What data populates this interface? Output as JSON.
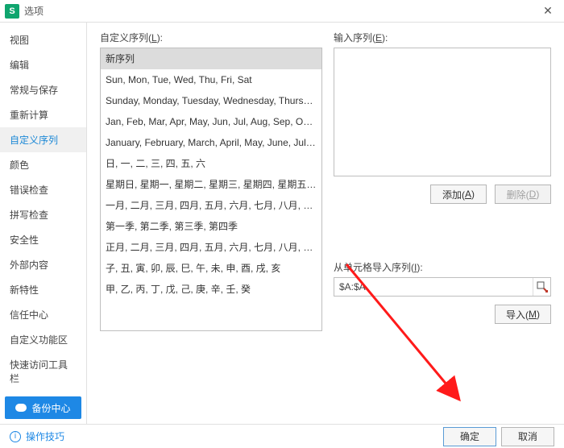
{
  "window": {
    "title": "选项"
  },
  "sidebar": {
    "items": [
      {
        "label": "视图"
      },
      {
        "label": "编辑"
      },
      {
        "label": "常规与保存"
      },
      {
        "label": "重新计算"
      },
      {
        "label": "自定义序列",
        "active": true
      },
      {
        "label": "颜色"
      },
      {
        "label": "错误检查"
      },
      {
        "label": "拼写检查"
      },
      {
        "label": "安全性"
      },
      {
        "label": "外部内容"
      },
      {
        "label": "新特性"
      },
      {
        "label": "信任中心"
      },
      {
        "label": "自定义功能区"
      },
      {
        "label": "快速访问工具栏"
      }
    ],
    "backup_label": "备份中心"
  },
  "custom_seq": {
    "label_prefix": "自定义序列(",
    "hotkey": "L",
    "label_suffix": "):",
    "rows": [
      "新序列",
      "Sun, Mon, Tue, Wed, Thu, Fri, Sat",
      "Sunday, Monday, Tuesday, Wednesday, Thursday, Frid...",
      "Jan, Feb, Mar, Apr, May, Jun, Jul, Aug, Sep, Oct, Nov, ...",
      "January, February, March, April, May, June, July, A...",
      "日, 一, 二, 三, 四, 五, 六",
      "星期日, 星期一, 星期二, 星期三, 星期四, 星期五, 星期六",
      "一月, 二月, 三月, 四月, 五月, 六月, 七月, 八月, 九月, 十月, ...",
      "第一季, 第二季, 第三季, 第四季",
      "正月, 二月, 三月, 四月, 五月, 六月, 七月, 八月, 九月, 十月, ...",
      "子, 丑, 寅, 卯, 辰, 巳, 午, 未, 申, 酉, 戌, 亥",
      "甲, 乙, 丙, 丁, 戊, 己, 庚, 辛, 壬, 癸"
    ],
    "selected_index": 0
  },
  "input_seq": {
    "label_prefix": "输入序列(",
    "hotkey": "E",
    "label_suffix": "):",
    "value": ""
  },
  "actions": {
    "add_label": "添加(",
    "add_hotkey": "A",
    "delete_label": "删除(",
    "delete_hotkey": "D",
    "import_label": "导入(",
    "import_hotkey": "M",
    "close_paren": ")"
  },
  "cell_import": {
    "label_prefix": "从单元格导入序列(",
    "hotkey": "I",
    "label_suffix": "):",
    "value": "$A:$A"
  },
  "footer": {
    "tips": "操作技巧",
    "ok": "确定",
    "cancel": "取消"
  }
}
